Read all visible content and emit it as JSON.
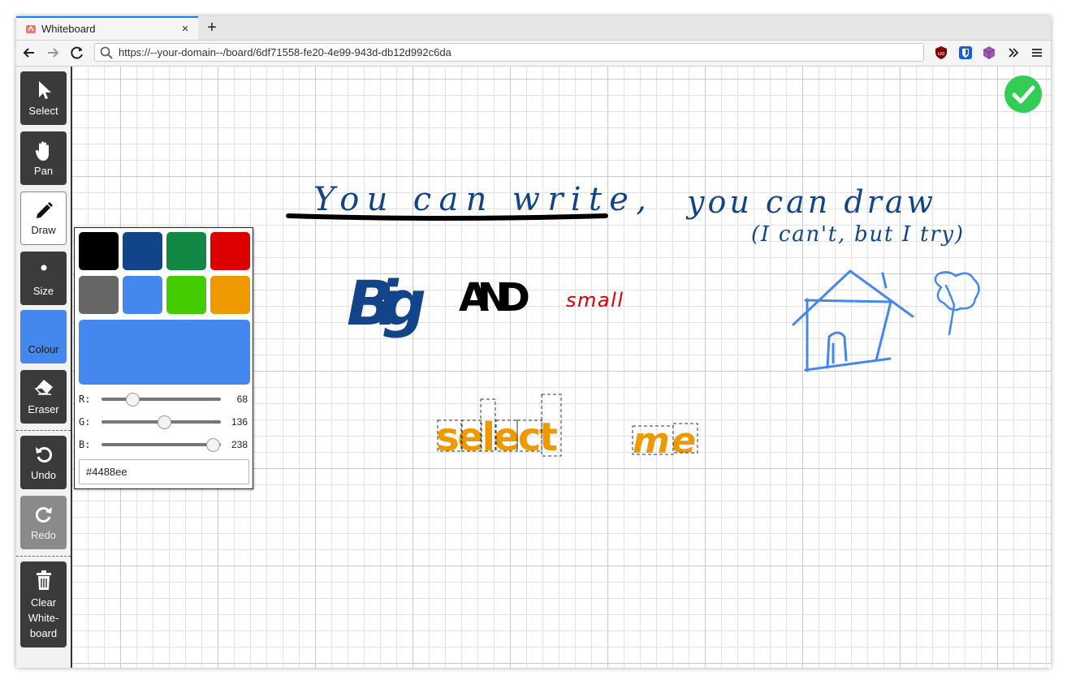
{
  "browser": {
    "tab_title": "Whiteboard",
    "tab_close": "×",
    "new_tab": "+",
    "url": "https://--your-domain--/board/6df71558-fe20-4e99-943d-db12d992c6da"
  },
  "tools": [
    {
      "label": "Select",
      "icon": "cursor-icon"
    },
    {
      "label": "Pan",
      "icon": "hand-icon"
    },
    {
      "label": "Draw",
      "icon": "pencil-icon",
      "active": true
    },
    {
      "label": "Size",
      "icon": "dot-icon"
    },
    {
      "label": "Colour",
      "icon": "colour-icon"
    },
    {
      "label": "Eraser",
      "icon": "eraser-icon"
    },
    {
      "label": "Undo",
      "icon": "undo-icon"
    },
    {
      "label": "Redo",
      "icon": "redo-icon",
      "disabled": true
    },
    {
      "label": "Clear\nWhite-\nboard",
      "icon": "trash-icon"
    }
  ],
  "colour_picker": {
    "swatches": [
      "#000000",
      "#114488",
      "#118844",
      "#dd0000",
      "#666666",
      "#4488ee",
      "#44cc00",
      "#ee9900"
    ],
    "current": "#4488ee",
    "r_label": "R:",
    "r_value": "68",
    "g_label": "G:",
    "g_value": "136",
    "b_label": "B:",
    "b_value": "238",
    "hex": "#4488ee"
  },
  "status": {
    "icon": "check-circle-icon",
    "color": "#33cc55"
  },
  "board_text": {
    "line1": "You can write,",
    "line1b": "you can draw",
    "line2": "(I can't, but I try)",
    "big": "Big",
    "and": "AND",
    "small": "small",
    "select": "select",
    "me": "me"
  },
  "colors": {
    "ink_blue": "#114488",
    "ink_black": "#000000",
    "ink_red": "#dd0000",
    "ink_orange": "#ee9900",
    "ink_light_blue": "#4488ee"
  }
}
